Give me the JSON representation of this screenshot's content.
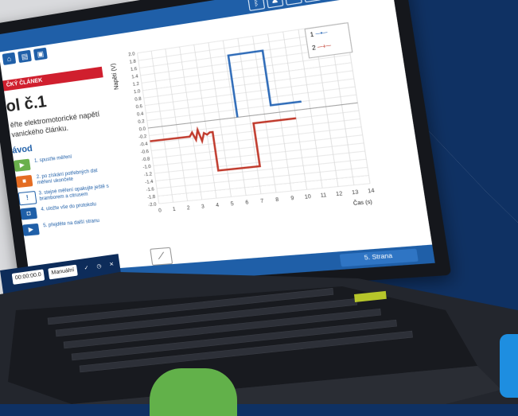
{
  "topbar": {
    "icons": [
      "bluetooth-icon",
      "users-icon",
      "share-icon",
      "window-icon",
      "camera-icon",
      "help-icon"
    ],
    "help_label": "?"
  },
  "nav": {
    "icons": [
      "home-icon",
      "document-icon",
      "document-plus-icon"
    ]
  },
  "section": {
    "band_label": "ČKÝ ČLÁNEK",
    "title": "ol č.1",
    "description": "ěřte elektromotorické napětí vanického článku."
  },
  "steps": {
    "heading": "ávod",
    "items": [
      {
        "label": "1. spusťte měření",
        "color": "#6ab04c",
        "icon": "play-icon"
      },
      {
        "label": "2. po získání potřebných dat měření ukončete",
        "color": "#e46c22",
        "icon": "stop-icon"
      },
      {
        "label": "3. stejné měření opakujte ještě s bramborem a citrusem",
        "color": "#1f5fa8",
        "icon": "exclamation-icon"
      },
      {
        "label": "4. uložte vše do protokolu",
        "color": "#1f5fa8",
        "icon": "camera-icon"
      },
      {
        "label": "5. přejděte na další stranu",
        "color": "#1f5fa8",
        "icon": "next-icon"
      }
    ]
  },
  "chart_data": {
    "type": "line",
    "ylabel": "Napětí (V)",
    "xlabel": "Čas (s)",
    "xlim": [
      0,
      14
    ],
    "ylim": [
      -2.0,
      2.0
    ],
    "x_ticks": [
      0,
      1,
      2,
      3,
      4,
      5,
      6,
      7,
      8,
      9,
      10,
      11,
      12,
      13,
      14
    ],
    "y_ticks": [
      "2.0",
      "1.8",
      "1.6",
      "1.4",
      "1.2",
      "1.0",
      "0.8",
      "0.6",
      "0.4",
      "0.2",
      "0.0",
      "-0.2",
      "-0.4",
      "-0.6",
      "-0.8",
      "-1.0",
      "-1.2",
      "-1.4",
      "-1.6",
      "-1.8",
      "-2.0"
    ],
    "series": [
      {
        "name": "1",
        "color": "#2e6bb8",
        "x": [
          6.2,
          6.2,
          8.5,
          8.5,
          10.5
        ],
        "y": [
          0.0,
          1.6,
          1.6,
          0.2,
          0.2
        ]
      },
      {
        "name": "2",
        "color": "#c0392b",
        "x": [
          0,
          2.8,
          3.0,
          3.2,
          3.4,
          3.6,
          3.8,
          4.0,
          4.2,
          4.4,
          4.4,
          7.2,
          7.2,
          8.5,
          10.0
        ],
        "y": [
          -0.35,
          -0.35,
          -0.25,
          -0.45,
          -0.2,
          -0.5,
          -0.3,
          -0.35,
          -0.3,
          -0.3,
          -1.3,
          -1.3,
          -0.2,
          -0.2,
          -0.2
        ]
      }
    ],
    "legend": [
      "1",
      "2"
    ],
    "grid": true
  },
  "bottombar": {
    "next_label": "5. Strana"
  },
  "taskbar": {
    "timer": "00:00:00.0",
    "mode": "Manuální"
  }
}
